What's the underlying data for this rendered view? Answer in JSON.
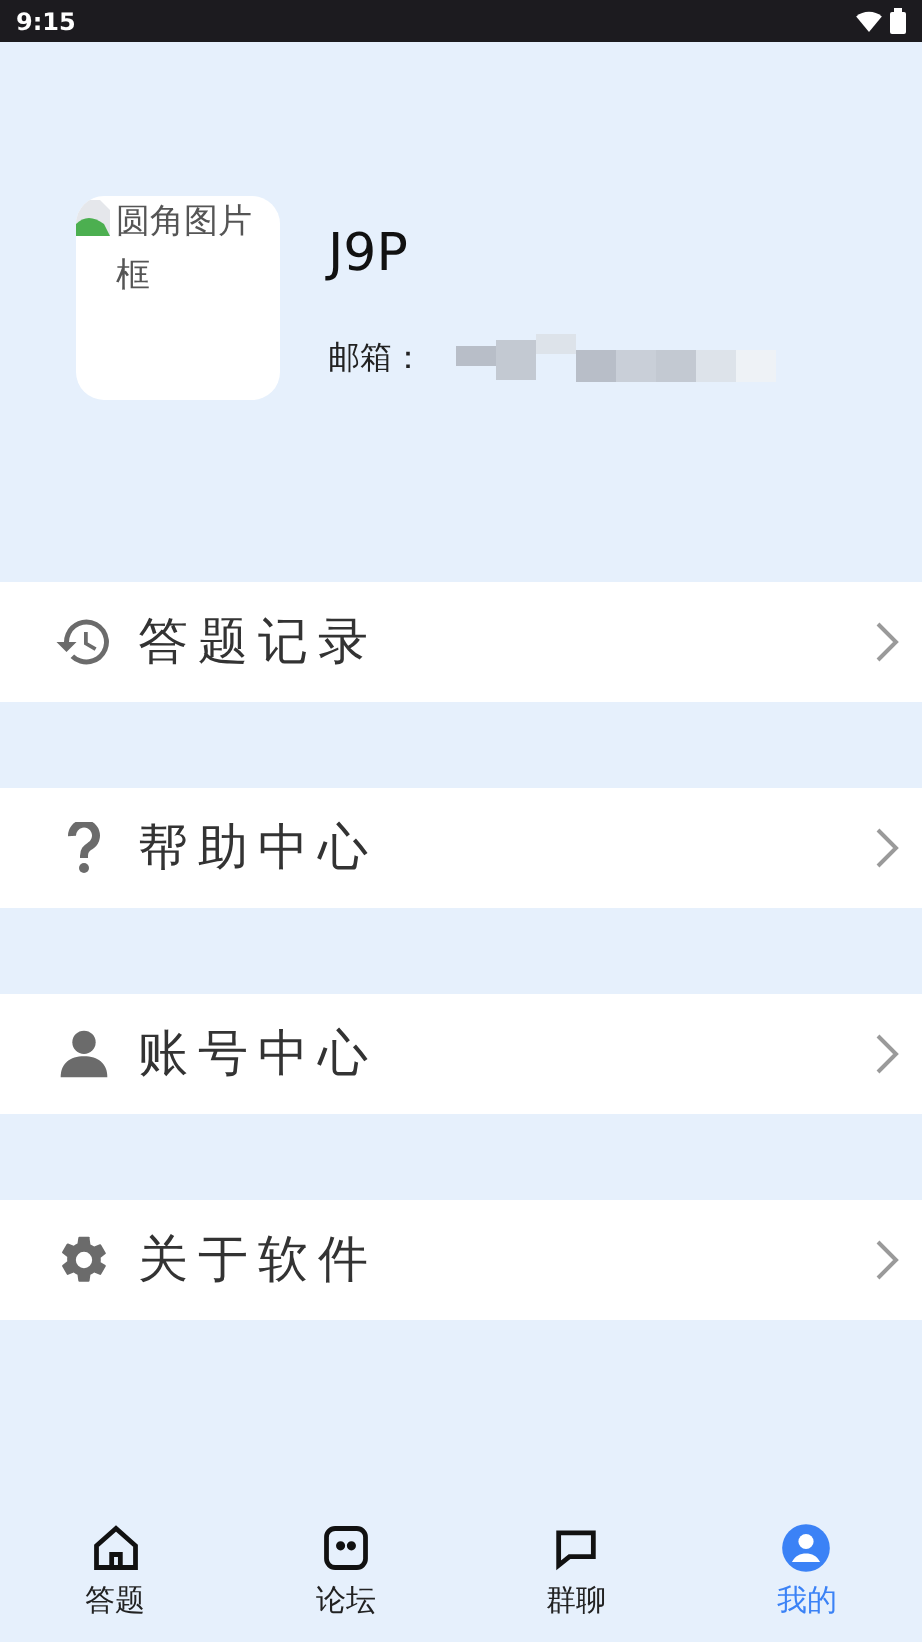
{
  "status_bar": {
    "time": "9:15"
  },
  "profile": {
    "avatar_alt": "圆角图片框",
    "name": "J9P",
    "email_label": "邮箱："
  },
  "menu": [
    {
      "label": "答题记录"
    },
    {
      "label": "帮助中心"
    },
    {
      "label": "账号中心"
    },
    {
      "label": "关于软件"
    }
  ],
  "tabs": [
    {
      "label": "答题",
      "selected": false
    },
    {
      "label": "论坛",
      "selected": false
    },
    {
      "label": "群聊",
      "selected": false
    },
    {
      "label": "我的",
      "selected": true
    }
  ]
}
